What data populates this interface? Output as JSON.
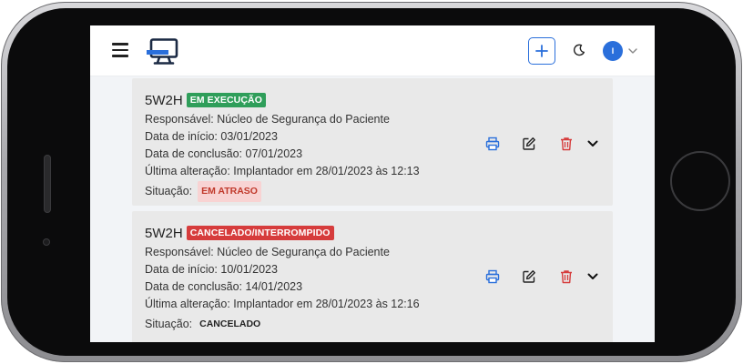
{
  "app": {
    "icons": {
      "menu": "hamburger-menu-icon",
      "logo": "monitor-logo-icon",
      "add": "plus-icon",
      "theme": "moon-icon",
      "user_chevron": "chevron-down-icon"
    },
    "colors": {
      "accent": "#2a6fdb",
      "success": "#2f9e5a",
      "danger": "#d63c3c",
      "card_bg": "#e9e9e9"
    },
    "user": {
      "initial": "I"
    }
  },
  "plans": [
    {
      "title": "5W2H",
      "status_badge": "EM EXECUÇÃO",
      "responsible": "Responsável: Núcleo de Segurança do Paciente",
      "start_date": "Data de início: 03/01/2023",
      "end_date": "Data de conclusão: 07/01/2023",
      "last_change": "Última alteração: Implantador em 28/01/2023 às 12:13",
      "situation_label": "Situação:",
      "situation_value": "EM ATRASO"
    },
    {
      "title": "5W2H",
      "status_badge": "CANCELADO/INTERROMPIDO",
      "responsible": "Responsável: Núcleo de Segurança do Paciente",
      "start_date": "Data de início: 10/01/2023",
      "end_date": "Data de conclusão: 14/01/2023",
      "last_change": "Última alteração: Implantador em 28/01/2023 às 12:16",
      "situation_label": "Situação:",
      "situation_value": "CANCELADO"
    }
  ],
  "card_actions": {
    "print": "printer-icon",
    "edit": "edit-icon",
    "delete": "trash-icon",
    "expand": "chevron-down-icon"
  }
}
